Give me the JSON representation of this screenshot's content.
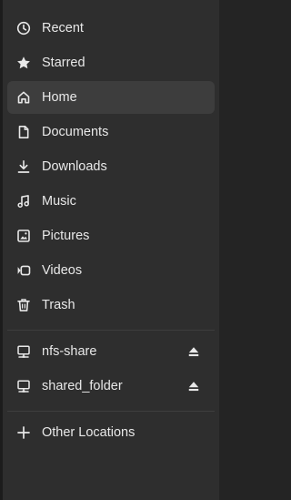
{
  "sidebar": {
    "places": [
      {
        "label": "Recent",
        "icon": "clock-icon"
      },
      {
        "label": "Starred",
        "icon": "star-icon"
      },
      {
        "label": "Home",
        "icon": "home-icon",
        "active": true
      },
      {
        "label": "Documents",
        "icon": "document-icon"
      },
      {
        "label": "Downloads",
        "icon": "download-icon"
      },
      {
        "label": "Music",
        "icon": "music-icon"
      },
      {
        "label": "Pictures",
        "icon": "picture-icon"
      },
      {
        "label": "Videos",
        "icon": "video-icon"
      },
      {
        "label": "Trash",
        "icon": "trash-icon"
      }
    ],
    "network": [
      {
        "label": "nfs-share",
        "icon": "network-drive-icon",
        "eject_icon": "eject-icon"
      },
      {
        "label": "shared_folder",
        "icon": "network-drive-icon",
        "eject_icon": "eject-icon"
      }
    ],
    "other_locations": {
      "label": "Other Locations",
      "icon": "plus-icon"
    }
  },
  "colors": {
    "sidebar_bg": "#2e2e2e",
    "active_bg": "#3d3d3d",
    "text": "#e8e8e8",
    "separator": "#3e3e3e"
  }
}
